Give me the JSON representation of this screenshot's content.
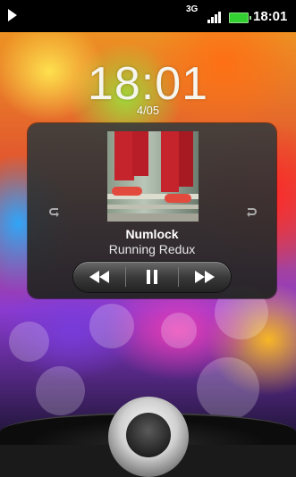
{
  "status_bar": {
    "network_type": "3G",
    "time": "18:01",
    "icons": [
      "media-play-icon",
      "3g-data-icon",
      "signal-strength-icon",
      "battery-icon"
    ]
  },
  "lockscreen": {
    "time": "18:01",
    "date": "4/05"
  },
  "music_widget": {
    "track_title": "Numlock",
    "artist": "Running Redux",
    "controls": [
      "previous-icon",
      "pause-icon",
      "next-icon"
    ],
    "side_icons": [
      "repeat-icon",
      "shuffle-back-icon"
    ]
  },
  "colors": {
    "battery": "#32d030",
    "panel_bg": "#2e2e2e"
  }
}
